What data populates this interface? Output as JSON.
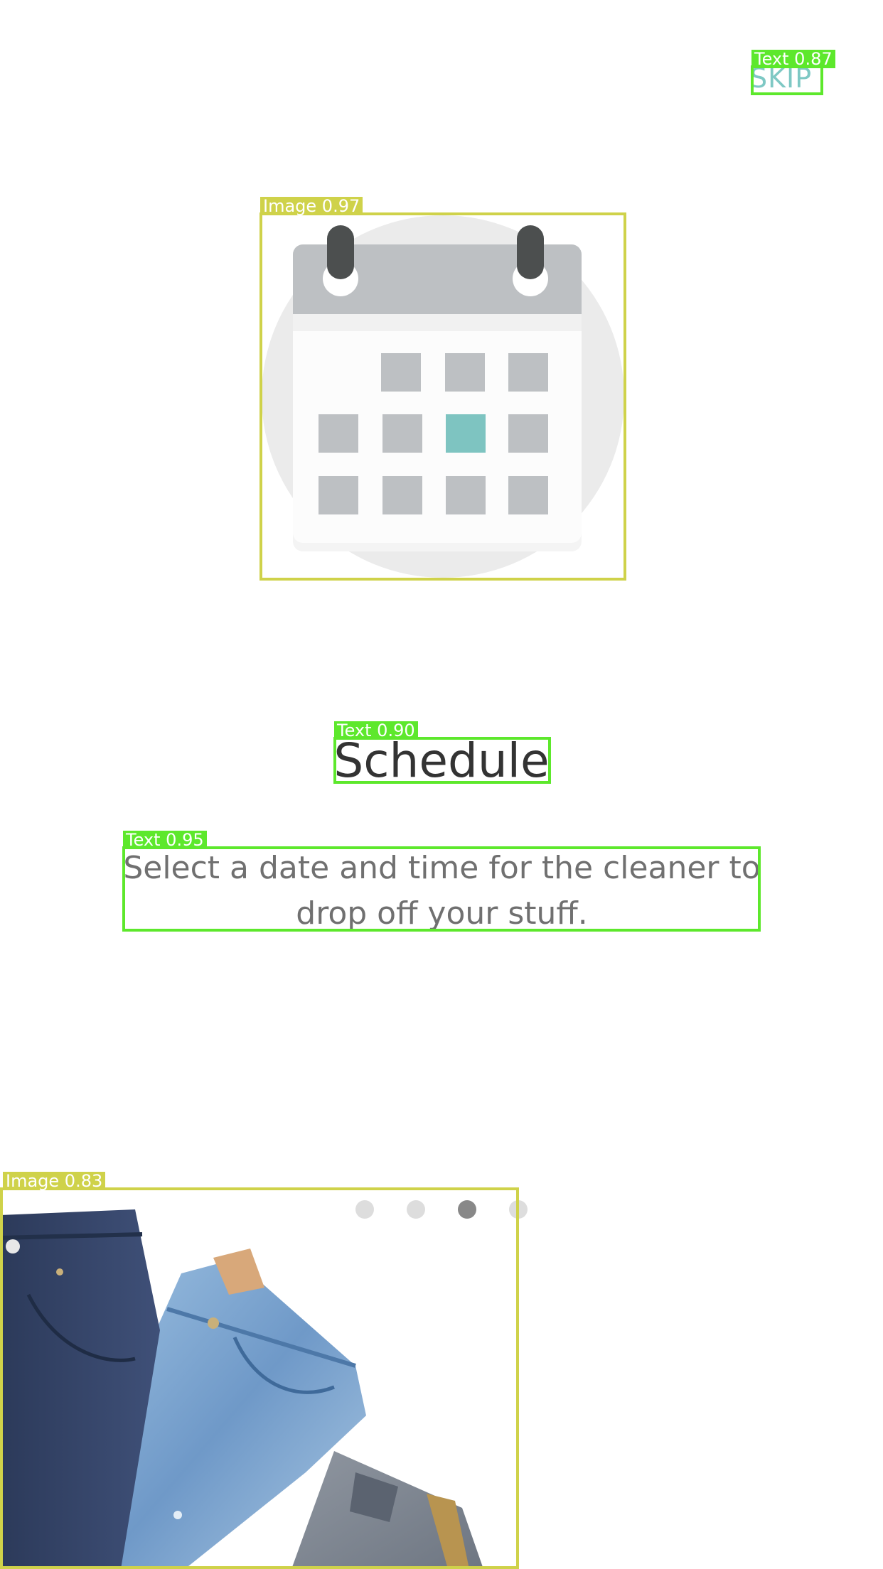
{
  "skip": {
    "label": "SKIP"
  },
  "onboarding": {
    "title": "Schedule",
    "description": "Select a date and time for the cleaner to drop off your stuff.",
    "pager": {
      "count": 4,
      "active_index": 2
    },
    "calendar_icon": "calendar-icon",
    "hero_image": "jeans-image"
  },
  "detections": [
    {
      "label": "Text 0.87"
    },
    {
      "label": "Image 0.97"
    },
    {
      "label": "Text 0.90"
    },
    {
      "label": "Text 0.95"
    },
    {
      "label": "Image 0.83"
    }
  ],
  "colors": {
    "accent": "#7ec8c4",
    "title": "#333333",
    "body_text": "#707070",
    "dot_inactive": "#dddddd",
    "dot_active": "#888888",
    "text_box": "#5de82c",
    "image_box": "#cfd24a"
  }
}
